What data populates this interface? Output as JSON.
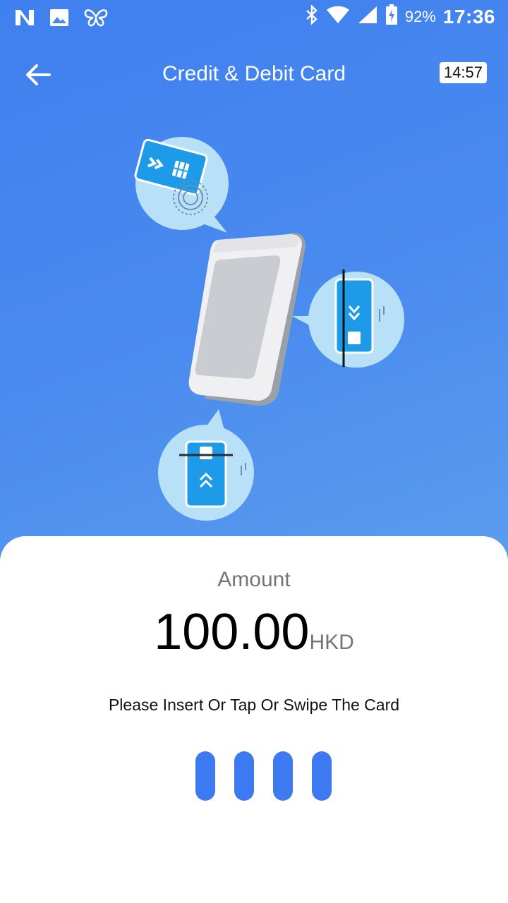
{
  "status_bar": {
    "icons": [
      "n-icon",
      "image-icon",
      "butterfly-icon"
    ],
    "right_icons": [
      "bluetooth-icon",
      "wifi-icon",
      "signal-icon",
      "battery-charging-icon"
    ],
    "battery": "92%",
    "time": "17:36"
  },
  "app_bar": {
    "title": "Credit & Debit Card",
    "timer": "14:57",
    "back_icon": "arrow-left-icon"
  },
  "illustration": {
    "name": "card-payment-terminal-illustration"
  },
  "payment": {
    "amount_label": "Amount",
    "amount": "100.00",
    "currency": "HKD",
    "instruction": "Please Insert Or Tap Or Swipe The Card"
  },
  "colors": {
    "header_blue": "#4a8bef",
    "accent": "#3d79f0"
  }
}
